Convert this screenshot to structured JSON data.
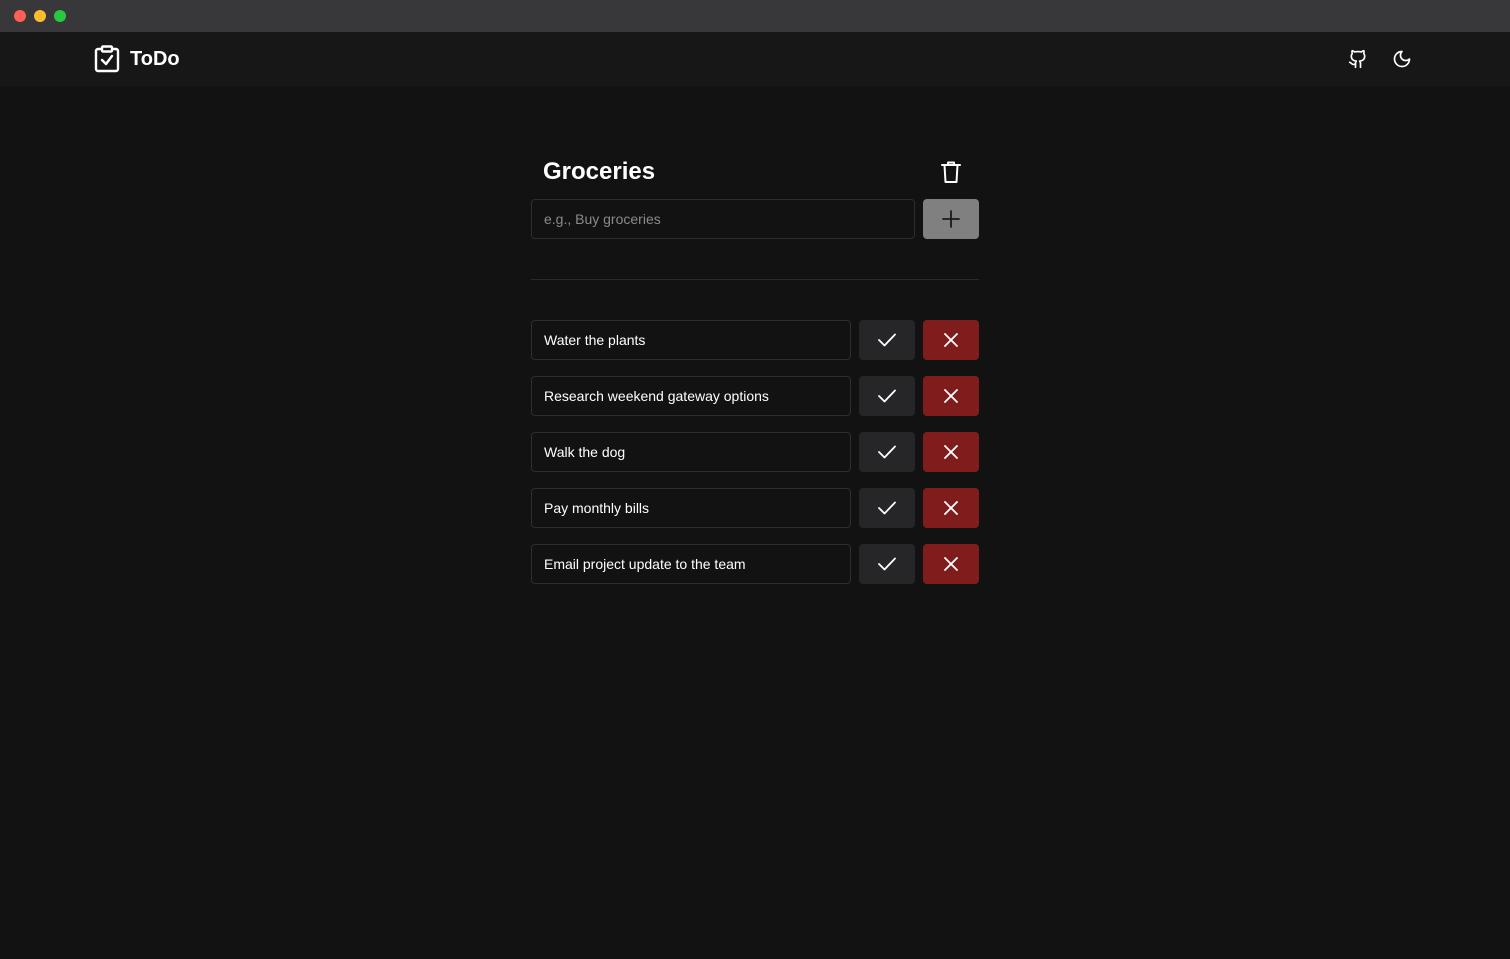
{
  "app": {
    "title": "ToDo"
  },
  "list": {
    "title": "Groceries",
    "input_placeholder": "e.g., Buy groceries",
    "input_value": ""
  },
  "tasks": [
    {
      "text": "Water the plants"
    },
    {
      "text": "Research weekend gateway options"
    },
    {
      "text": "Walk the dog"
    },
    {
      "text": "Pay monthly bills"
    },
    {
      "text": "Email project update to the team"
    }
  ],
  "icons": {
    "brand": "clipboard-check-icon",
    "github": "github-icon",
    "theme": "moon-icon",
    "delete_list": "trash-icon",
    "add": "plus-icon",
    "complete": "check-icon",
    "remove": "x-icon"
  },
  "colors": {
    "background": "#121212",
    "navbar": "#171717",
    "add_button": "#808080",
    "complete_button": "#262628",
    "remove_button": "#7f1d1d"
  }
}
